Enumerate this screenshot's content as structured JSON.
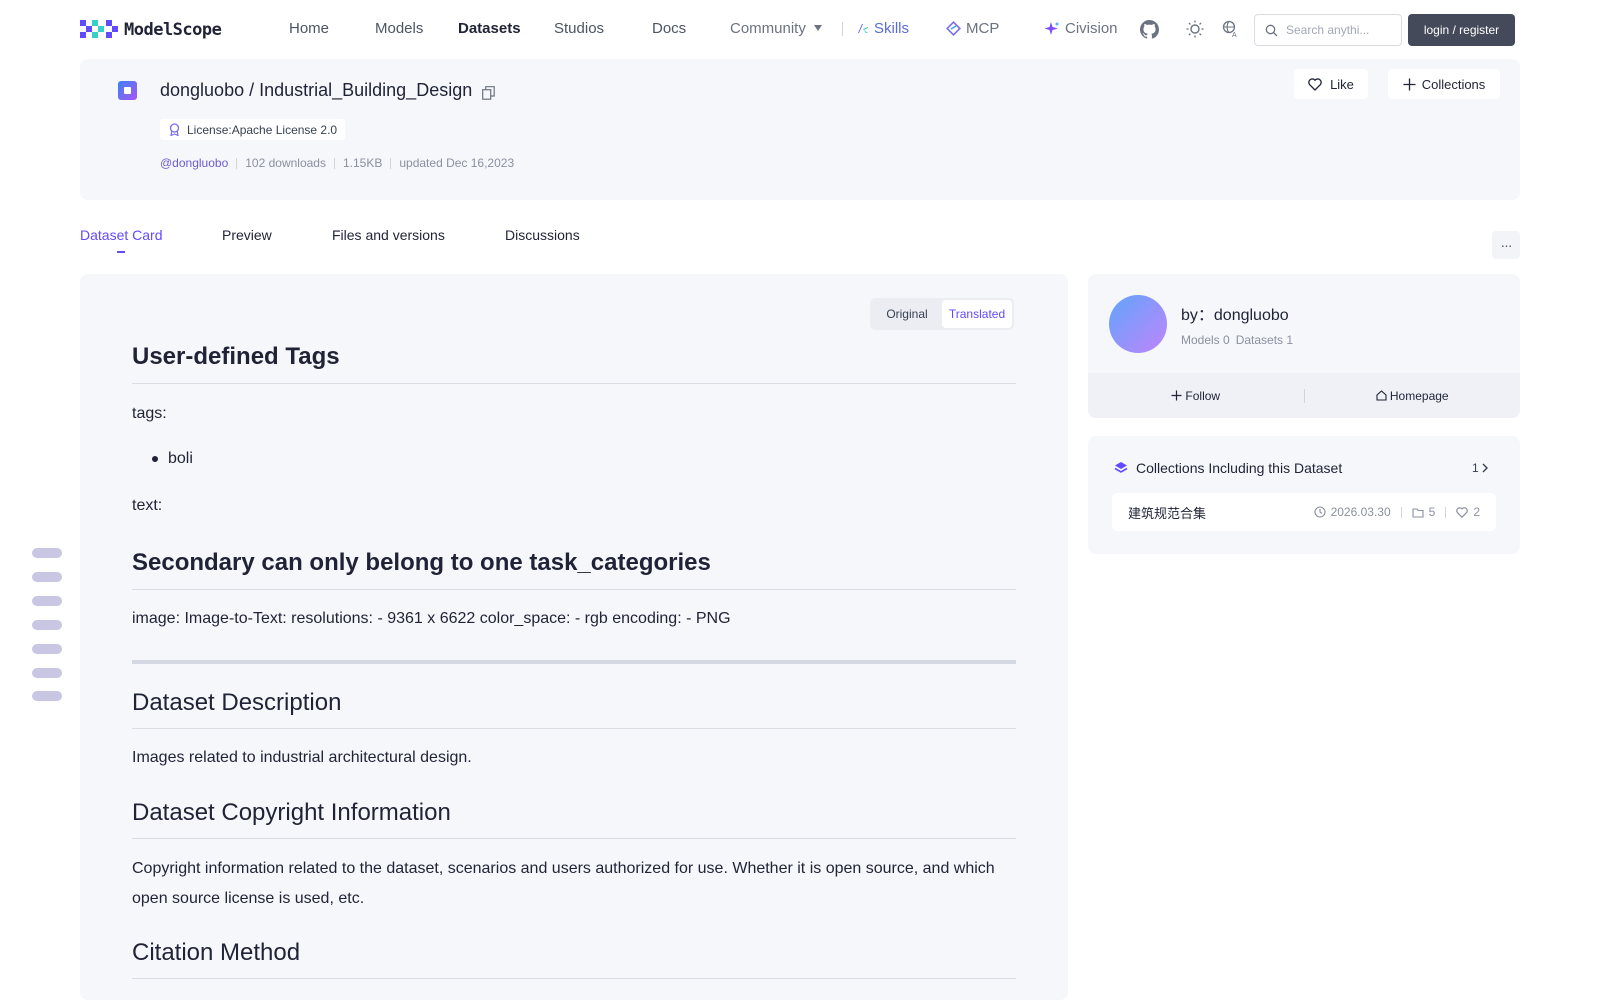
{
  "nav": {
    "logo_text": "ModelScope",
    "links": [
      "Home",
      "Models",
      "Datasets",
      "Studios",
      "Docs"
    ],
    "community": "Community",
    "skills": "Skills",
    "mcp": "MCP",
    "civision": "Civision",
    "search_placeholder": "Search anythi...",
    "login": "login / register",
    "accent": "#624aff"
  },
  "dataset": {
    "title": "dongluobo / Industrial_Building_Design",
    "license": "License:Apache License 2.0",
    "author_handle": "@dongluobo",
    "downloads": "102 downloads",
    "size": "1.15KB",
    "updated": "updated Dec 16,2023",
    "like": "Like",
    "collections": "Collections"
  },
  "tabs": [
    "Dataset Card",
    "Preview",
    "Files and versions",
    "Discussions"
  ],
  "more": "···",
  "toggle": {
    "original": "Original",
    "translated": "Translated"
  },
  "card": {
    "h_tags": "User-defined Tags",
    "tags_label": "tags:",
    "tag_item": "boli",
    "text_label": "text:",
    "h_secondary": "Secondary can only belong to one task_categories",
    "image_line": "image: Image-to-Text: resolutions: - 9361 x 6622 color_space: - rgb encoding: - PNG",
    "h_desc": "Dataset Description",
    "desc": "Images related to industrial architectural design.",
    "h_copyright": "Dataset Copyright Information",
    "copyright": "Copyright information related to the dataset, scenarios and users authorized for use. Whether it is open source, and which open source license is used, etc.",
    "h_citation": "Citation Method"
  },
  "author": {
    "by": "by：dongluobo",
    "models": "Models 0",
    "datasets": "Datasets 1",
    "follow": "Follow",
    "homepage": "Homepage"
  },
  "collections_panel": {
    "heading": "Collections Including this Dataset",
    "count": "1",
    "item_name": "建筑规范合集",
    "item_date": "2026.03.30",
    "item_items": "5",
    "item_likes": "2"
  }
}
